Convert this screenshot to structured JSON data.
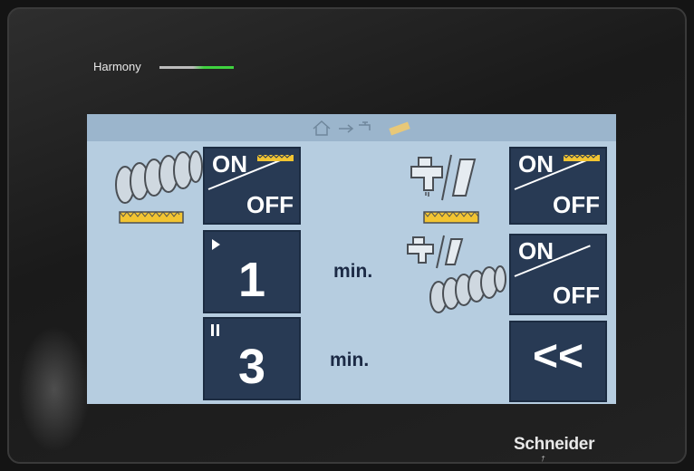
{
  "device": {
    "brand_label": "Harmony",
    "manufacturer": "Schneider",
    "manufacturer_sub": "Electric"
  },
  "screen": {
    "header": {
      "icons": [
        "home-icon",
        "arrow-right-icon",
        "faucet-icon",
        "bristles-icon"
      ]
    },
    "left_panel": {
      "illustration": "brush-roller-icon",
      "toggle": {
        "on_label": "ON",
        "off_label": "OFF"
      },
      "run_timer": {
        "value": "1",
        "unit": "min.",
        "icon": "play-icon"
      },
      "pause_timer": {
        "value": "3",
        "unit": "min.",
        "icon": "pause-icon"
      }
    },
    "right_panel": {
      "water_toggle": {
        "on_label": "ON",
        "off_label": "OFF",
        "icon": "faucet-and-brush-icon"
      },
      "roller_water_toggle": {
        "on_label": "ON",
        "off_label": "OFF",
        "icon": "faucet-and-roller-icon"
      },
      "back_button": {
        "label": "<<"
      }
    }
  },
  "colors": {
    "screen_bg": "#b6cde0",
    "tile_bg": "#283a54",
    "accent_yellow": "#f2c432",
    "label_text": "#1c2a45"
  }
}
